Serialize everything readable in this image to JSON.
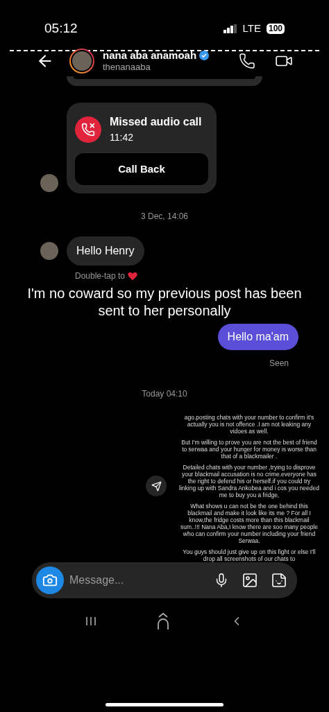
{
  "status_bar": {
    "time": "05:12",
    "network": "LTE",
    "battery": "100"
  },
  "header": {
    "name": "nana aba anamoah",
    "verified": true,
    "username": "thenanaaba"
  },
  "missed_call": {
    "title": "Missed audio call",
    "time": "11:42",
    "button": "Call Back"
  },
  "timestamp_1": "3 Dec, 14:06",
  "incoming": {
    "text": "Hello Henry",
    "hint": "Double-tap to"
  },
  "caption": "I'm no coward so my previous post has been sent to her personally",
  "outgoing": {
    "text": "Hello ma'am",
    "status": "Seen"
  },
  "timestamp_2": "Today 04:10",
  "shared_note": {
    "paragraphs": [
      "ago.posting chats with your number to confirm it's actually you is not offence .I am not leaking any vidoes as well.",
      "But I'm willing to prove you are not the best of friend to serwaa and your hunger for money is worse than that of a blackmailer .",
      "Detailed chats with your number ,trying to disprove your blackmail accusation is no crime.everyone has the right to defend his or herself.if you could try linking up with Sandra Ankobea and i cos you needed me to buy you a fridge,",
      "What shows u can not be the one behind this blackmail and make it look like its me ? For all I know,the fridge costs more than this blackmail sum..!!! Nana Aba,I know there are soo many people who can confirm your number including your friend Serwaa.",
      "You guys should just give up on this fight or else I'll drop all screenshots of our chats to"
    ]
  },
  "composer": {
    "placeholder": "Message..."
  }
}
